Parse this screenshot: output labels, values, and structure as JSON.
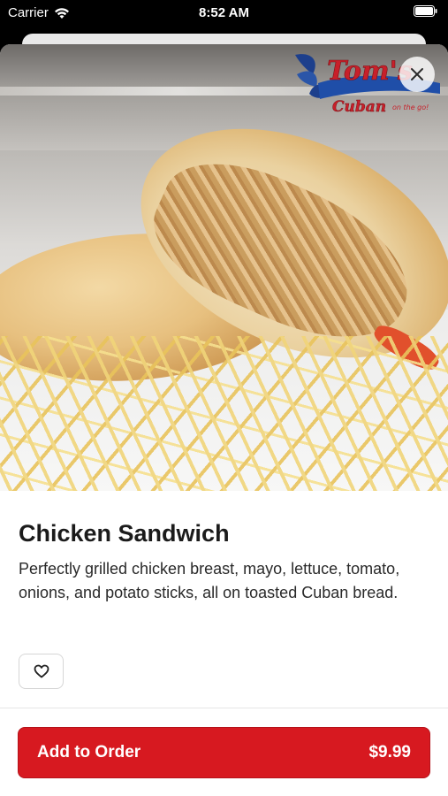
{
  "status_bar": {
    "carrier": "Carrier",
    "time": "8:52 AM"
  },
  "logo": {
    "brand": "Tom's",
    "sub": "Cuban",
    "tagline": "on the go!"
  },
  "item": {
    "title": "Chicken Sandwich",
    "description": "Perfectly grilled chicken breast, mayo, lettuce, tomato, onions, and potato sticks, all on toasted Cuban bread."
  },
  "actions": {
    "add_to_order_label": "Add to Order",
    "price": "$9.99"
  },
  "colors": {
    "accent": "#d71920"
  },
  "icons": {
    "close": "close-icon",
    "favorite": "heart-icon",
    "wifi": "wifi-icon",
    "battery": "battery-icon"
  }
}
